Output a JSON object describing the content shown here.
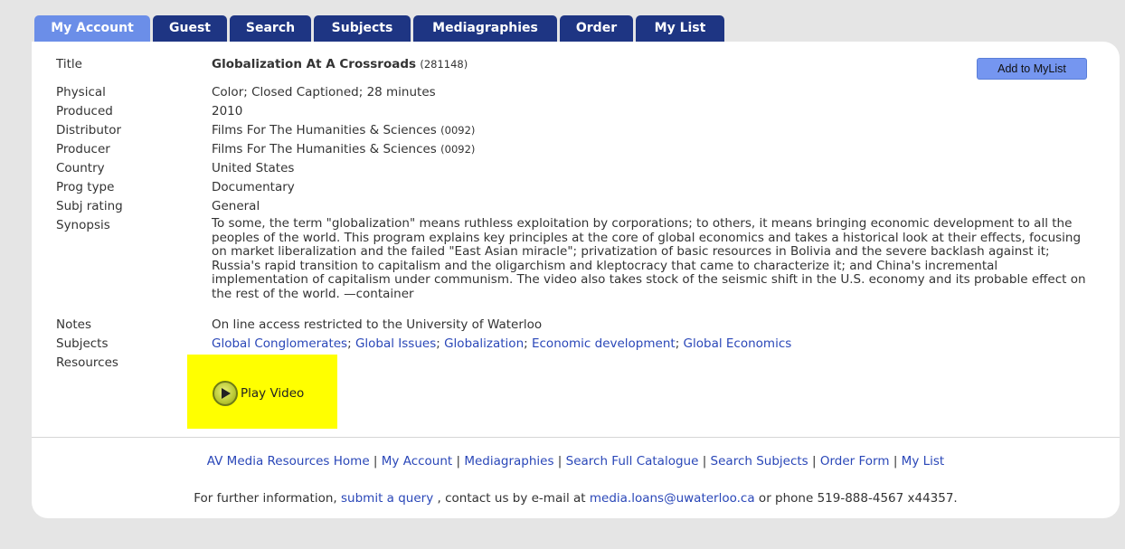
{
  "tabs": [
    {
      "label": "My Account",
      "active": true
    },
    {
      "label": "Guest"
    },
    {
      "label": "Search"
    },
    {
      "label": "Subjects"
    },
    {
      "label": "Mediagraphies"
    },
    {
      "label": "Order"
    },
    {
      "label": "My List"
    }
  ],
  "record": {
    "labels": {
      "title": "Title",
      "physical": "Physical",
      "produced": "Produced",
      "distributor": "Distributor",
      "producer": "Producer",
      "country": "Country",
      "prog_type": "Prog type",
      "subj_rating": "Subj rating",
      "synopsis": "Synopsis",
      "notes": "Notes",
      "subjects": "Subjects",
      "resources": "Resources"
    },
    "title": "Globalization At A Crossroads",
    "title_id": "(281148)",
    "physical": "Color; Closed Captioned; 28 minutes",
    "produced": "2010",
    "distributor": "Films For The Humanities & Sciences",
    "distributor_id": "(0092)",
    "producer": "Films For The Humanities & Sciences",
    "producer_id": "(0092)",
    "country": "United States",
    "prog_type": "Documentary",
    "subj_rating": "General",
    "synopsis": "To some, the term \"globalization\" means ruthless exploitation by corporations; to others, it means bringing economic development to all the peoples of the world. This program explains key principles at the core of global economics and takes a historical look at their effects, focusing on market liberalization and the failed \"East Asian miracle\"; privatization of basic resources in Bolivia and the severe backlash against it; Russia's rapid transition to capitalism and the oligarchism and kleptocracy that came to characterize it; and China's incremental implementation of capitalism under communism. The video also takes stock of the seismic shift in the U.S. economy and its probable effect on the rest of the world. —container",
    "notes": "On line access restricted to the University of Waterloo",
    "subjects": [
      "Global Conglomerates",
      "Global Issues",
      "Globalization",
      "Economic development",
      "Global Economics"
    ],
    "subject_separator": "; "
  },
  "buttons": {
    "add_to_mylist": "Add to MyList",
    "play_video": "Play Video"
  },
  "footer": {
    "links": [
      "AV Media Resources Home",
      "My Account",
      "Mediagraphies",
      "Search Full Catalogue",
      "Search Subjects",
      "Order Form",
      "My List"
    ],
    "link_separator": " | ",
    "info_prefix": "For further information, ",
    "info_link": "submit a query",
    "info_mid": " , contact us by e-mail at ",
    "info_email": "media.loans@uwaterloo.ca",
    "info_suffix": " or phone 519-888-4567 x44357."
  },
  "colors": {
    "tab": "#1e3583",
    "tab_active": "#6b8ee8",
    "link": "#2a47b8",
    "highlight": "#ffff00",
    "button": "#7596f0"
  },
  "icons": {
    "play": "play-circle-icon"
  }
}
